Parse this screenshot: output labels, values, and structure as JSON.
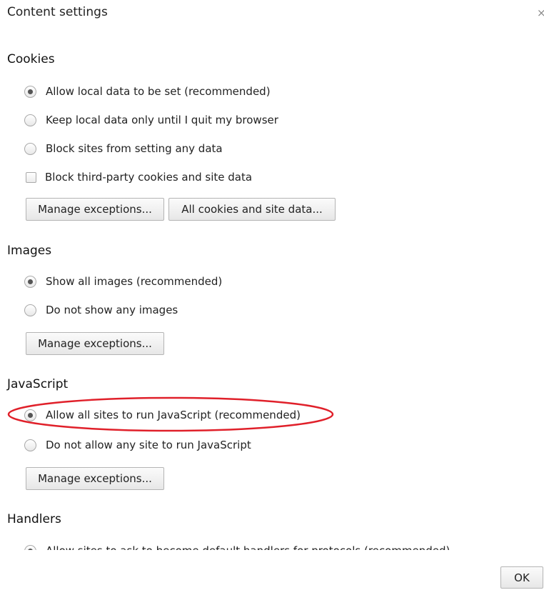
{
  "dialog": {
    "title": "Content settings",
    "close_glyph": "×",
    "ok_label": "OK"
  },
  "cookies": {
    "title": "Cookies",
    "options": [
      {
        "label": "Allow local data to be set (recommended)",
        "checked": true
      },
      {
        "label": "Keep local data only until I quit my browser",
        "checked": false
      },
      {
        "label": "Block sites from setting any data",
        "checked": false
      }
    ],
    "checkbox_label": "Block third-party cookies and site data",
    "checkbox_checked": false,
    "manage_label": "Manage exceptions...",
    "all_cookies_label": "All cookies and site data..."
  },
  "images": {
    "title": "Images",
    "options": [
      {
        "label": "Show all images (recommended)",
        "checked": true
      },
      {
        "label": "Do not show any images",
        "checked": false
      }
    ],
    "manage_label": "Manage exceptions..."
  },
  "javascript": {
    "title": "JavaScript",
    "options": [
      {
        "label": "Allow all sites to run JavaScript (recommended)",
        "checked": true
      },
      {
        "label": "Do not allow any site to run JavaScript",
        "checked": false
      }
    ],
    "manage_label": "Manage exceptions..."
  },
  "handlers": {
    "title": "Handlers",
    "options": [
      {
        "label": "Allow sites to ask to become default handlers for protocols (recommended)",
        "checked": true
      }
    ]
  },
  "annotation": {
    "color": "#e0202a"
  }
}
